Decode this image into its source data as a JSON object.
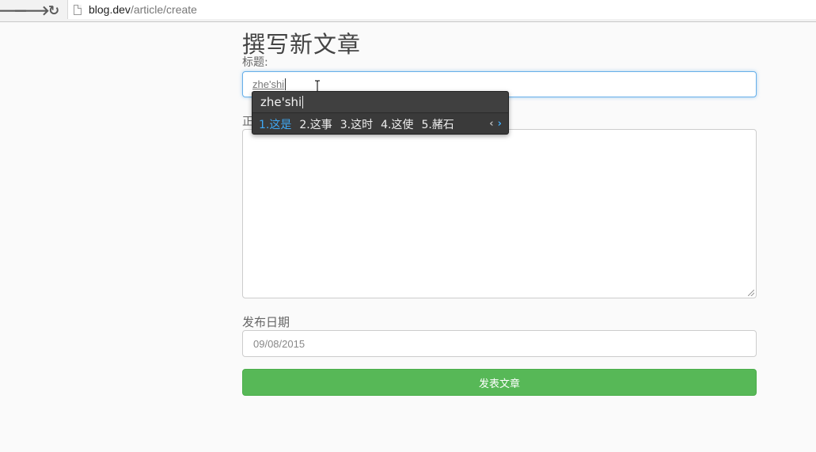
{
  "browser": {
    "url_host": "blog.dev",
    "url_path": "/article/create",
    "back_glyph": "🡐",
    "forward_glyph": "🡒",
    "reload_glyph": "↻"
  },
  "page": {
    "title": "撰写新文章",
    "title_label": "标题:",
    "body_label": "正",
    "date_label": "发布日期",
    "title_value": "zhe'shi",
    "date_value": "09/08/2015",
    "submit_label": "发表文章"
  },
  "ime": {
    "composition": "zhe'shi",
    "candidates": [
      {
        "label": "1.这是"
      },
      {
        "label": "2.这事"
      },
      {
        "label": "3.这时"
      },
      {
        "label": "4.这使"
      },
      {
        "label": "5.赭石"
      }
    ],
    "prev_glyph": "‹",
    "next_glyph": "›"
  },
  "colors": {
    "focus_border": "#66afe9",
    "submit_bg": "#57b857",
    "ime_bg": "#3a3a3a",
    "ime_selected": "#3fa9f5"
  },
  "icons": {
    "back": "back-arrow-icon",
    "forward": "forward-arrow-icon",
    "reload": "reload-icon",
    "page": "page-icon",
    "cursor": "text-cursor-icon",
    "resize": "resize-grip-icon"
  }
}
